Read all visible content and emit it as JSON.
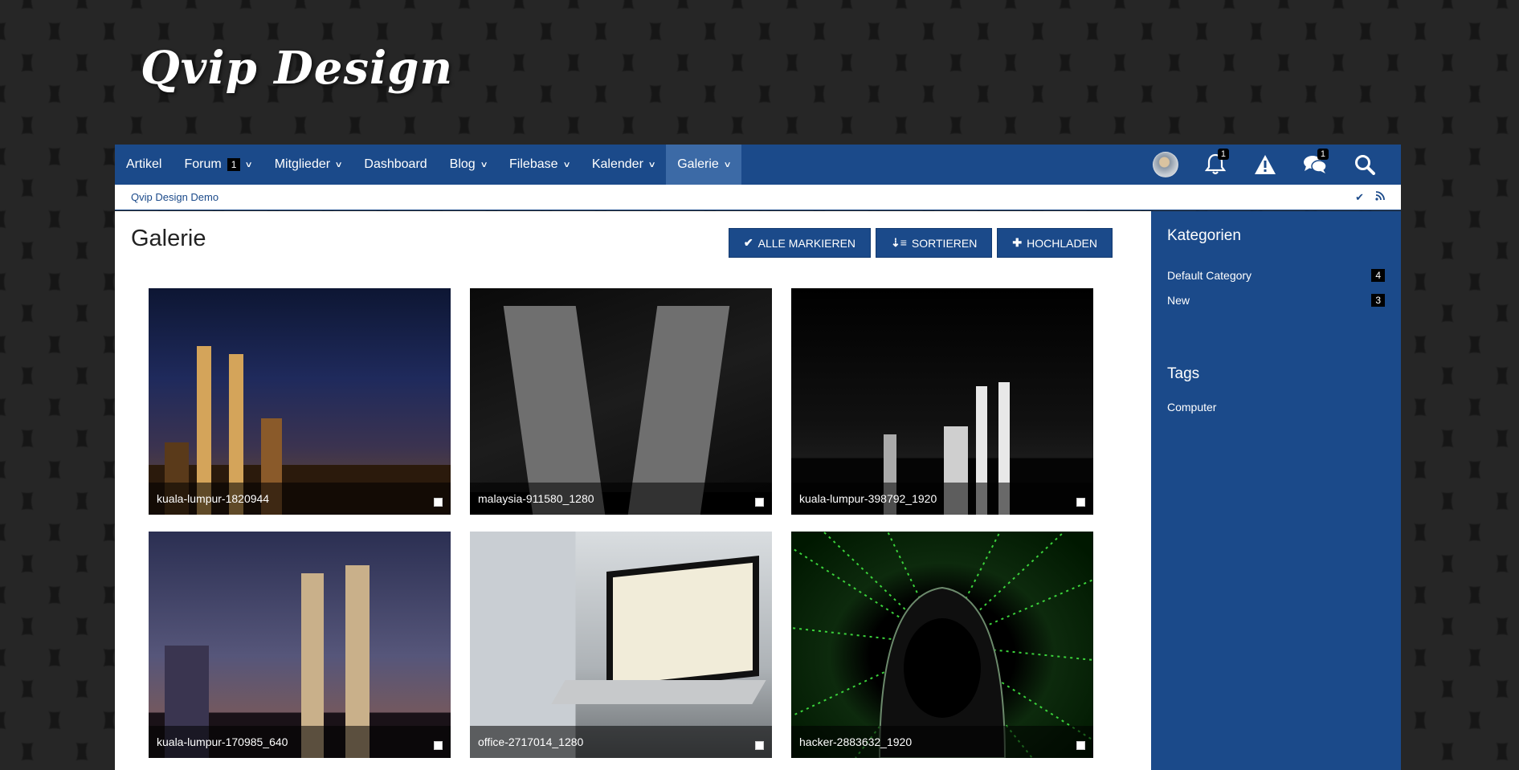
{
  "site": {
    "logo": "Qvip Design"
  },
  "nav": {
    "items": [
      {
        "label": "Artikel",
        "dropdown": false
      },
      {
        "label": "Forum",
        "badge": "1",
        "dropdown": true
      },
      {
        "label": "Mitglieder",
        "dropdown": true
      },
      {
        "label": "Dashboard",
        "dropdown": false
      },
      {
        "label": "Blog",
        "dropdown": true
      },
      {
        "label": "Filebase",
        "dropdown": true
      },
      {
        "label": "Kalender",
        "dropdown": true
      },
      {
        "label": "Galerie",
        "dropdown": true,
        "active": true
      }
    ],
    "notifications_badge": "1",
    "conversations_badge": "1",
    "icons": [
      "avatar",
      "bell-icon",
      "warning-icon",
      "comments-icon",
      "search-icon"
    ]
  },
  "breadcrumb": {
    "label": "Qvip Design Demo"
  },
  "page": {
    "title": "Galerie",
    "buttons": {
      "mark_all": "ALLE MARKIEREN",
      "sort": "SORTIEREN",
      "upload": "HOCHLADEN"
    }
  },
  "gallery": [
    {
      "caption": "kuala-lumpur-1820944"
    },
    {
      "caption": "malaysia-911580_1280"
    },
    {
      "caption": "kuala-lumpur-398792_1920"
    },
    {
      "caption": "kuala-lumpur-170985_640"
    },
    {
      "caption": "office-2717014_1280"
    },
    {
      "caption": "hacker-2883632_1920"
    }
  ],
  "sidebar": {
    "categories_title": "Kategorien",
    "categories": [
      {
        "label": "Default Category",
        "count": "4"
      },
      {
        "label": "New",
        "count": "3"
      }
    ],
    "tags_title": "Tags",
    "tags": [
      "Computer"
    ]
  },
  "colors": {
    "primary": "#1b4a8a",
    "active_tab": "#3c6aa6",
    "badge": "#000000"
  }
}
